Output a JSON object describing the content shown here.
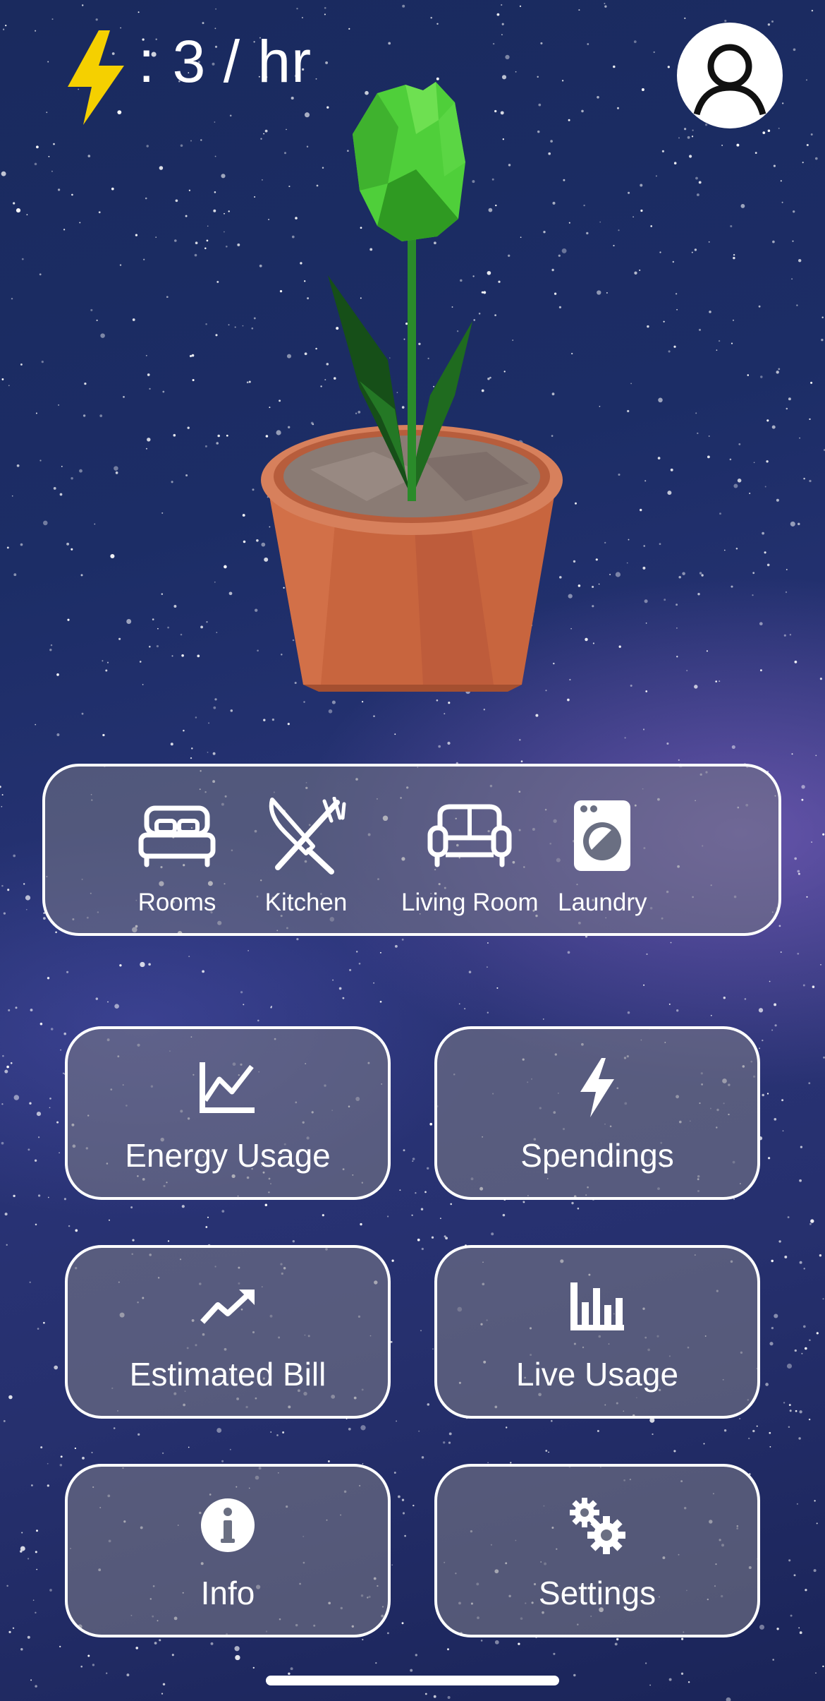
{
  "energy_rate": ": 3 / hr",
  "rooms": [
    {
      "label": "Rooms",
      "icon": "bed-icon"
    },
    {
      "label": "Kitchen",
      "icon": "utensils-icon"
    },
    {
      "label": "Living Room",
      "icon": "sofa-icon"
    },
    {
      "label": "Laundry",
      "icon": "washing-machine-icon"
    }
  ],
  "tiles": [
    {
      "label": "Energy Usage",
      "icon": "line-chart-icon"
    },
    {
      "label": "Spendings",
      "icon": "bolt-icon"
    },
    {
      "label": "Estimated Bill",
      "icon": "trending-up-icon"
    },
    {
      "label": "Live Usage",
      "icon": "bar-chart-icon"
    },
    {
      "label": "Info",
      "icon": "info-icon"
    },
    {
      "label": "Settings",
      "icon": "gears-icon"
    }
  ],
  "colors": {
    "bolt": "#f5d000",
    "plant_bud": "#4fcf3a",
    "plant_leaf": "#1f6b1f",
    "pot": "#c8653e",
    "soil": "#8a7b74",
    "panel_border": "#ffffff"
  }
}
